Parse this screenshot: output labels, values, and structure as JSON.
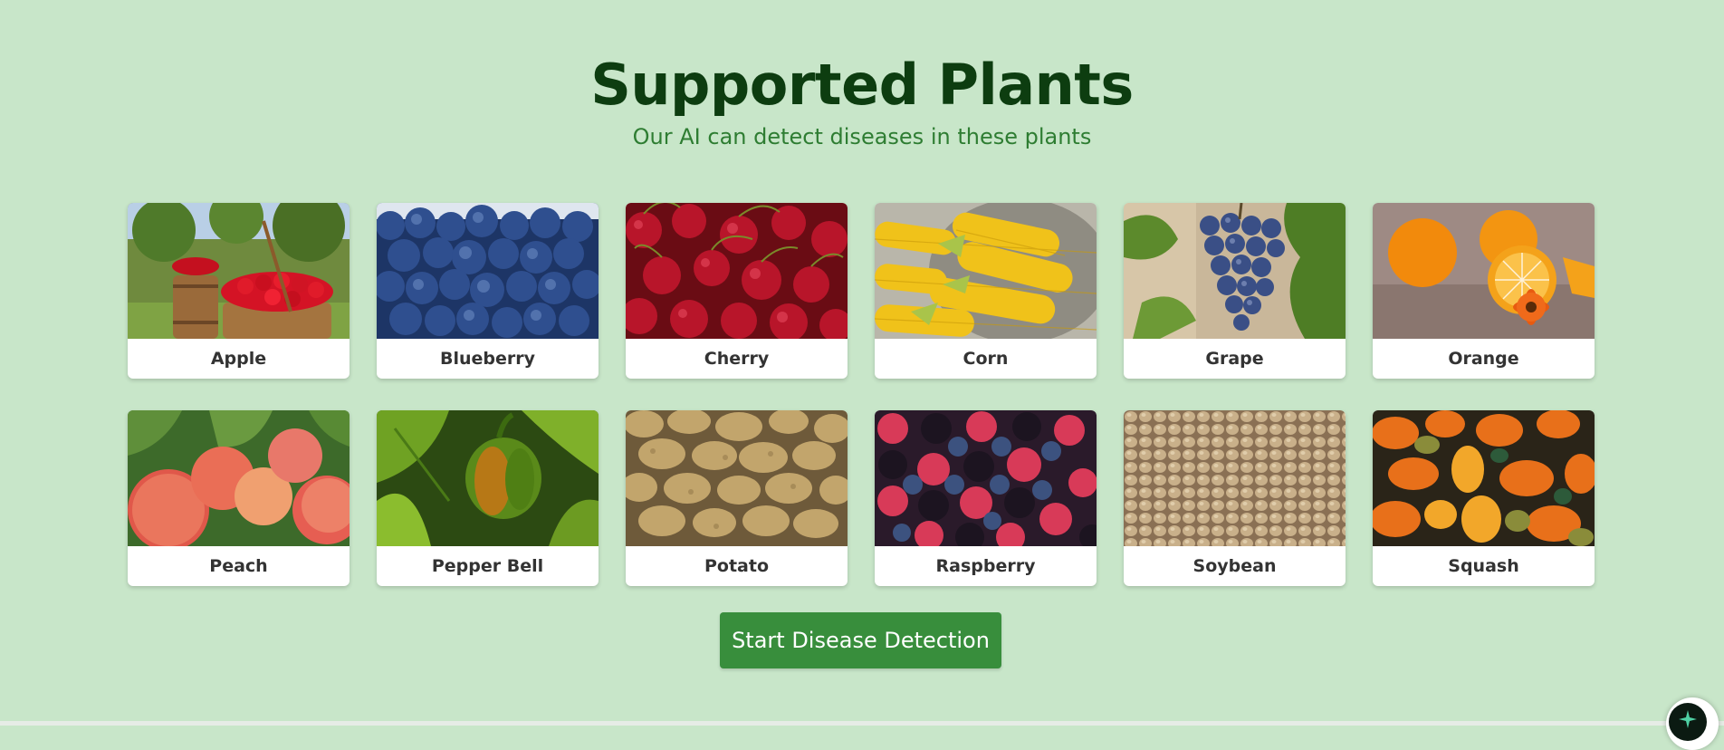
{
  "header": {
    "title": "Supported Plants",
    "subtitle": "Our AI can detect diseases in these plants"
  },
  "plants": [
    {
      "label": "Apple",
      "image": "apple-photo"
    },
    {
      "label": "Blueberry",
      "image": "blueberry-photo"
    },
    {
      "label": "Cherry",
      "image": "cherry-photo"
    },
    {
      "label": "Corn",
      "image": "corn-photo"
    },
    {
      "label": "Grape",
      "image": "grape-photo"
    },
    {
      "label": "Orange",
      "image": "orange-photo"
    },
    {
      "label": "Peach",
      "image": "peach-photo"
    },
    {
      "label": "Pepper Bell",
      "image": "pepper-bell-photo"
    },
    {
      "label": "Potato",
      "image": "potato-photo"
    },
    {
      "label": "Raspberry",
      "image": "raspberry-photo"
    },
    {
      "label": "Soybean",
      "image": "soybean-photo"
    },
    {
      "label": "Squash",
      "image": "squash-photo"
    }
  ],
  "cta": {
    "label": "Start Disease Detection"
  },
  "colors": {
    "background": "#c8e6c9",
    "title": "#0d3d10",
    "subtitle": "#2e7d32",
    "button": "#388e3c",
    "card": "#ffffff"
  },
  "chat_widget": {
    "icon": "sparkle-icon"
  }
}
